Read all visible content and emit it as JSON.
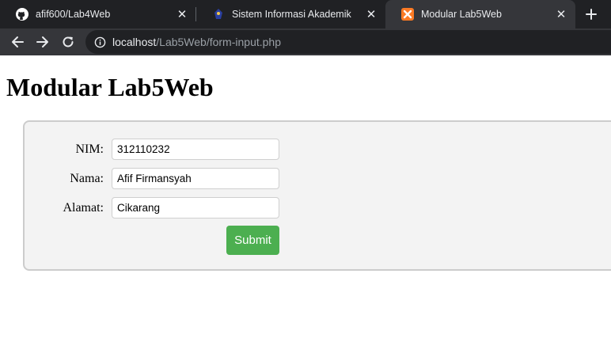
{
  "browser": {
    "tabs": [
      {
        "title": "afif600/Lab4Web",
        "icon": "github-icon"
      },
      {
        "title": "Sistem Informasi Akademik",
        "icon": "university-logo-icon"
      },
      {
        "title": "Modular Lab5Web",
        "icon": "xampp-icon",
        "active": true
      }
    ],
    "address": {
      "host": "localhost",
      "path": "/Lab5Web/form-input.php"
    }
  },
  "page": {
    "title": "Modular Lab5Web",
    "form": {
      "fields": [
        {
          "label": "NIM:",
          "value": "312110232"
        },
        {
          "label": "Nama:",
          "value": "Afif Firmansyah"
        },
        {
          "label": "Alamat:",
          "value": "Cikarang"
        }
      ],
      "submit_label": "Submit"
    }
  },
  "colors": {
    "chrome_dark": "#202124",
    "chrome_active": "#35363a",
    "submit_green": "#4caf50",
    "form_bg": "#f3f3f3"
  }
}
